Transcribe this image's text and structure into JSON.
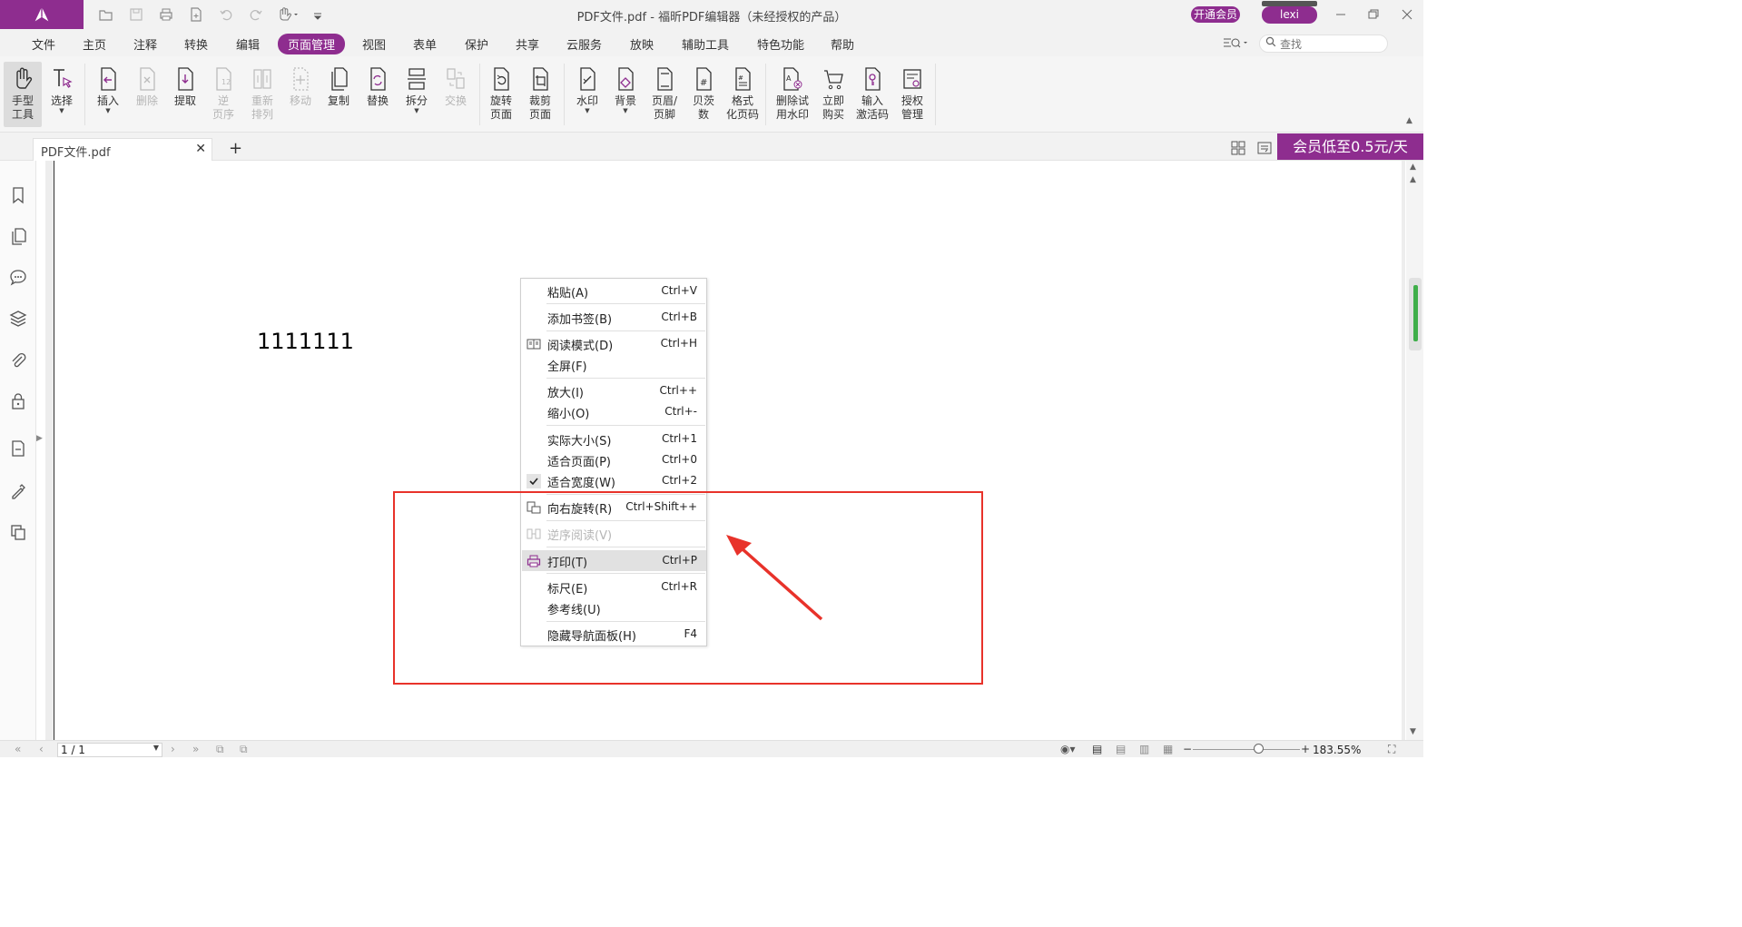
{
  "window": {
    "title": "PDF文件.pdf - 福昕PDF编辑器（未经授权的产品）",
    "vip_label": "开通会员",
    "user_name": "lexi"
  },
  "menubar": {
    "items": [
      "文件",
      "主页",
      "注释",
      "转换",
      "编辑",
      "页面管理",
      "视图",
      "表单",
      "保护",
      "共享",
      "云服务",
      "放映",
      "辅助工具",
      "特色功能",
      "帮助"
    ],
    "active": "页面管理",
    "search_placeholder": "查找"
  },
  "ribbon": {
    "buttons": [
      {
        "label": "手型\n工具",
        "icon": "hand-icon",
        "enabled": true
      },
      {
        "label": "选择",
        "icon": "select-text-icon",
        "enabled": true
      },
      {
        "label": "插入",
        "icon": "insert-page-icon",
        "enabled": true
      },
      {
        "label": "删除",
        "icon": "delete-page-icon",
        "enabled": false
      },
      {
        "label": "提取",
        "icon": "extract-page-icon",
        "enabled": true
      },
      {
        "label": "逆\n页序",
        "icon": "reverse-order-icon",
        "enabled": false
      },
      {
        "label": "重新\n排列",
        "icon": "rearrange-icon",
        "enabled": false
      },
      {
        "label": "移动",
        "icon": "move-page-icon",
        "enabled": false
      },
      {
        "label": "复制",
        "icon": "copy-page-icon",
        "enabled": true
      },
      {
        "label": "替换",
        "icon": "replace-page-icon",
        "enabled": true
      },
      {
        "label": "拆分",
        "icon": "split-icon",
        "enabled": true
      },
      {
        "label": "交换",
        "icon": "swap-icon",
        "enabled": false
      },
      {
        "label": "旋转\n页面",
        "icon": "rotate-page-icon",
        "enabled": true
      },
      {
        "label": "裁剪\n页面",
        "icon": "crop-page-icon",
        "enabled": true
      },
      {
        "label": "水印",
        "icon": "watermark-icon",
        "enabled": true
      },
      {
        "label": "背景",
        "icon": "background-icon",
        "enabled": true
      },
      {
        "label": "页眉/\n页脚",
        "icon": "header-footer-icon",
        "enabled": true
      },
      {
        "label": "贝茨\n数",
        "icon": "bates-number-icon",
        "enabled": true
      },
      {
        "label": "格式\n化页码",
        "icon": "format-page-number-icon",
        "enabled": true
      },
      {
        "label": "删除试\n用水印",
        "icon": "remove-trial-watermark-icon",
        "enabled": true
      },
      {
        "label": "立即\n购买",
        "icon": "shopping-cart-icon",
        "enabled": true
      },
      {
        "label": "输入\n激活码",
        "icon": "activation-key-icon",
        "enabled": true
      },
      {
        "label": "授权\n管理",
        "icon": "license-manage-icon",
        "enabled": true
      }
    ]
  },
  "tabs": {
    "document_tab": "PDF文件.pdf",
    "promo": "会员低至0.5元/天"
  },
  "document": {
    "page_text": "1111111"
  },
  "context_menu": {
    "items": [
      {
        "label": "粘贴(A)",
        "shortcut": "Ctrl+V",
        "enabled": true
      },
      {
        "label": "添加书签(B)",
        "shortcut": "Ctrl+B",
        "enabled": true
      },
      {
        "label": "阅读模式(D)",
        "shortcut": "Ctrl+H",
        "enabled": true,
        "icon": "reading-mode-icon"
      },
      {
        "label": "全屏(F)",
        "shortcut": "",
        "enabled": true
      },
      {
        "label": "放大(I)",
        "shortcut": "Ctrl++",
        "enabled": true
      },
      {
        "label": "缩小(O)",
        "shortcut": "Ctrl+-",
        "enabled": true
      },
      {
        "label": "实际大小(S)",
        "shortcut": "Ctrl+1",
        "enabled": true
      },
      {
        "label": "适合页面(P)",
        "shortcut": "Ctrl+0",
        "enabled": true
      },
      {
        "label": "适合宽度(W)",
        "shortcut": "Ctrl+2",
        "enabled": true,
        "checked": true
      },
      {
        "label": "向右旋转(R)",
        "shortcut": "Ctrl+Shift++",
        "enabled": true,
        "icon": "rotate-right-icon"
      },
      {
        "label": "逆序阅读(V)",
        "shortcut": "",
        "enabled": false,
        "icon": "reverse-reading-icon"
      },
      {
        "label": "打印(T)",
        "shortcut": "Ctrl+P",
        "enabled": true,
        "icon": "print-icon",
        "highlighted": true
      },
      {
        "label": "标尺(E)",
        "shortcut": "Ctrl+R",
        "enabled": true
      },
      {
        "label": "参考线(U)",
        "shortcut": "",
        "enabled": true
      },
      {
        "label": "隐藏导航面板(H)",
        "shortcut": "F4",
        "enabled": true
      }
    ]
  },
  "statusbar": {
    "page_indicator": "1 / 1",
    "zoom": "183.55%"
  },
  "colors": {
    "brand": "#8e2d8f",
    "annotation": "#e8322a"
  }
}
